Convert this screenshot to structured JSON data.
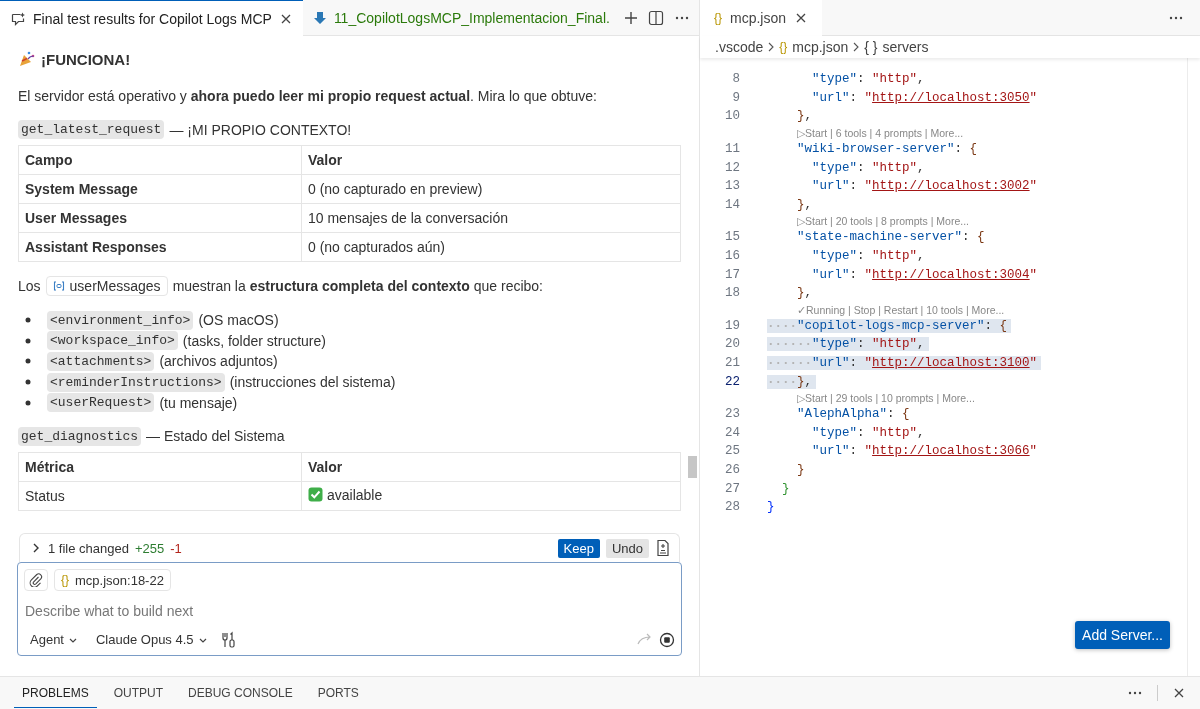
{
  "chat_tabs": [
    {
      "kind": "chat",
      "label": "Final test results for Copilot Logs MCP",
      "selected": true
    },
    {
      "kind": "file",
      "label": "11_CopilotLogsMCP_Implementacion_Final.",
      "selected": false
    }
  ],
  "chat": {
    "blocks": [
      {
        "kind": "heading",
        "text": "¡FUNCIONA!"
      },
      {
        "kind": "paragraph",
        "text": "El servidor está operativo y **ahora puedo leer mi propio request actual**. Mira lo que obtuve:"
      },
      {
        "kind": "tool",
        "code": "get_latest_request",
        "text": "— ¡MI PROPIO CONTEXTO!"
      },
      {
        "kind": "table",
        "bold_labels": true,
        "columns": [
          "Campo",
          "Valor"
        ],
        "rows": [
          {
            "cells": [
              "System Message",
              "0 (no capturado en preview)"
            ]
          },
          {
            "cells": [
              "User Messages",
              "10 mensajes de la conversación"
            ]
          },
          {
            "cells": [
              "Assistant Responses",
              "0 (no capturados aún)"
            ]
          }
        ]
      },
      {
        "kind": "reference",
        "before": "Los",
        "chip": "userMessages",
        "after": "muestran la **estructura completa del contexto** que recibo:"
      },
      {
        "kind": "list",
        "items": [
          {
            "code": "<environment_info>",
            "text": "(OS macOS)"
          },
          {
            "code": "<workspace_info>",
            "text": "(tasks, folder structure)"
          },
          {
            "code": "<attachments>",
            "text": "(archivos adjuntos)"
          },
          {
            "code": "<reminderInstructions>",
            "text": "(instrucciones del sistema)"
          },
          {
            "code": "<userRequest>",
            "text": "(tu mensaje)"
          }
        ]
      },
      {
        "kind": "tool",
        "code": "get_diagnostics",
        "text": "— Estado del Sistema"
      },
      {
        "kind": "table",
        "bold_labels": false,
        "columns": [
          "Métrica",
          "Valor"
        ],
        "rows": [
          {
            "cells": [
              "Status",
              "available"
            ],
            "checked": true
          }
        ]
      }
    ]
  },
  "changes": {
    "expanded": false,
    "summary": "1 file changed",
    "added": "+255",
    "removed": "-1",
    "keep": "Keep",
    "undo": "Undo"
  },
  "composer": {
    "attachment_icon": "{}",
    "attachment": "mcp.json:18-22",
    "placeholder": "Describe what to build next",
    "mode": "Agent",
    "model": "Claude Opus 4.5",
    "send_disabled": true
  },
  "editor_tabs": [
    {
      "icon": "{}",
      "label": "mcp.json",
      "selected": true
    }
  ],
  "breadcrumb": [
    {
      "text": ".vscode"
    },
    {
      "icon": "{}",
      "text": "mcp.json"
    },
    {
      "icon": "{ }",
      "text": "servers"
    }
  ],
  "code": [
    {
      "kind": "line",
      "number": "8",
      "selected": false,
      "current": false,
      "tokens": [
        {
          "kind": "key",
          "text": "      \"type\""
        },
        {
          "kind": "punct",
          "text": ": "
        },
        {
          "kind": "string",
          "text": "\"http\""
        },
        {
          "kind": "punct",
          "text": ","
        }
      ]
    },
    {
      "kind": "line",
      "number": "9",
      "selected": false,
      "current": false,
      "tokens": [
        {
          "kind": "key",
          "text": "      \"url\""
        },
        {
          "kind": "punct",
          "text": ": "
        },
        {
          "kind": "string",
          "text": "\""
        },
        {
          "kind": "link",
          "text": "http://localhost:3050"
        },
        {
          "kind": "string",
          "text": "\""
        }
      ]
    },
    {
      "kind": "line",
      "number": "10",
      "selected": false,
      "current": false,
      "tokens": [
        {
          "kind": "inner",
          "text": "    }"
        },
        {
          "kind": "punct",
          "text": ","
        }
      ]
    },
    {
      "kind": "lens",
      "text": "▷Start | 6 tools | 4 prompts | More..."
    },
    {
      "kind": "line",
      "number": "11",
      "selected": false,
      "current": false,
      "tokens": [
        {
          "kind": "key",
          "text": "    \"wiki-browser-server\""
        },
        {
          "kind": "punct",
          "text": ": "
        },
        {
          "kind": "inner",
          "text": "{"
        }
      ]
    },
    {
      "kind": "line",
      "number": "12",
      "selected": false,
      "current": false,
      "tokens": [
        {
          "kind": "key",
          "text": "      \"type\""
        },
        {
          "kind": "punct",
          "text": ": "
        },
        {
          "kind": "string",
          "text": "\"http\""
        },
        {
          "kind": "punct",
          "text": ","
        }
      ]
    },
    {
      "kind": "line",
      "number": "13",
      "selected": false,
      "current": false,
      "tokens": [
        {
          "kind": "key",
          "text": "      \"url\""
        },
        {
          "kind": "punct",
          "text": ": "
        },
        {
          "kind": "string",
          "text": "\""
        },
        {
          "kind": "link",
          "text": "http://localhost:3002"
        },
        {
          "kind": "string",
          "text": "\""
        }
      ]
    },
    {
      "kind": "line",
      "number": "14",
      "selected": false,
      "current": false,
      "tokens": [
        {
          "kind": "inner",
          "text": "    }"
        },
        {
          "kind": "punct",
          "text": ","
        }
      ]
    },
    {
      "kind": "lens",
      "text": "▷Start | 20 tools | 8 prompts | More..."
    },
    {
      "kind": "line",
      "number": "15",
      "selected": false,
      "current": false,
      "tokens": [
        {
          "kind": "key",
          "text": "    \"state-machine-server\""
        },
        {
          "kind": "punct",
          "text": ": "
        },
        {
          "kind": "inner",
          "text": "{"
        }
      ]
    },
    {
      "kind": "line",
      "number": "16",
      "selected": false,
      "current": false,
      "tokens": [
        {
          "kind": "key",
          "text": "      \"type\""
        },
        {
          "kind": "punct",
          "text": ": "
        },
        {
          "kind": "string",
          "text": "\"http\""
        },
        {
          "kind": "punct",
          "text": ","
        }
      ]
    },
    {
      "kind": "line",
      "number": "17",
      "selected": false,
      "current": false,
      "tokens": [
        {
          "kind": "key",
          "text": "      \"url\""
        },
        {
          "kind": "punct",
          "text": ": "
        },
        {
          "kind": "string",
          "text": "\""
        },
        {
          "kind": "link",
          "text": "http://localhost:3004"
        },
        {
          "kind": "string",
          "text": "\""
        }
      ]
    },
    {
      "kind": "line",
      "number": "18",
      "selected": false,
      "current": false,
      "tokens": [
        {
          "kind": "inner",
          "text": "    }"
        },
        {
          "kind": "punct",
          "text": ","
        }
      ]
    },
    {
      "kind": "lens",
      "text": "✓Running | Stop | Restart | 10 tools | More..."
    },
    {
      "kind": "line",
      "number": "19",
      "selected": true,
      "current": false,
      "tokens": [
        {
          "kind": "key",
          "text": "    \"copilot-logs-mcp-server\""
        },
        {
          "kind": "punct",
          "text": ": "
        },
        {
          "kind": "inner",
          "text": "{"
        }
      ]
    },
    {
      "kind": "line",
      "number": "20",
      "selected": true,
      "current": false,
      "tokens": [
        {
          "kind": "key",
          "text": "      \"type\""
        },
        {
          "kind": "punct",
          "text": ": "
        },
        {
          "kind": "string",
          "text": "\"http\""
        },
        {
          "kind": "punct",
          "text": ","
        }
      ]
    },
    {
      "kind": "line",
      "number": "21",
      "selected": true,
      "current": false,
      "tokens": [
        {
          "kind": "key",
          "text": "      \"url\""
        },
        {
          "kind": "punct",
          "text": ": "
        },
        {
          "kind": "string",
          "text": "\""
        },
        {
          "kind": "link",
          "text": "http://localhost:3100"
        },
        {
          "kind": "string",
          "text": "\""
        }
      ]
    },
    {
      "kind": "line",
      "number": "22",
      "selected": true,
      "current": true,
      "tokens": [
        {
          "kind": "inner",
          "text": "    }"
        },
        {
          "kind": "punct",
          "text": ","
        }
      ]
    },
    {
      "kind": "lens",
      "text": "▷Start | 29 tools | 10 prompts | More..."
    },
    {
      "kind": "line",
      "number": "23",
      "selected": false,
      "current": false,
      "tokens": [
        {
          "kind": "key",
          "text": "    \"AlephAlpha\""
        },
        {
          "kind": "punct",
          "text": ": "
        },
        {
          "kind": "inner",
          "text": "{"
        }
      ]
    },
    {
      "kind": "line",
      "number": "24",
      "selected": false,
      "current": false,
      "tokens": [
        {
          "kind": "key",
          "text": "      \"type\""
        },
        {
          "kind": "punct",
          "text": ": "
        },
        {
          "kind": "string",
          "text": "\"http\""
        },
        {
          "kind": "punct",
          "text": ","
        }
      ]
    },
    {
      "kind": "line",
      "number": "25",
      "selected": false,
      "current": false,
      "tokens": [
        {
          "kind": "key",
          "text": "      \"url\""
        },
        {
          "kind": "punct",
          "text": ": "
        },
        {
          "kind": "string",
          "text": "\""
        },
        {
          "kind": "link",
          "text": "http://localhost:3066"
        },
        {
          "kind": "string",
          "text": "\""
        }
      ]
    },
    {
      "kind": "line",
      "number": "26",
      "selected": false,
      "current": false,
      "tokens": [
        {
          "kind": "inner",
          "text": "    }"
        }
      ]
    },
    {
      "kind": "line",
      "number": "27",
      "selected": false,
      "current": false,
      "tokens": [
        {
          "kind": "middle",
          "text": "  }"
        }
      ]
    },
    {
      "kind": "line",
      "number": "28",
      "selected": false,
      "current": false,
      "tokens": [
        {
          "kind": "outer",
          "text": "}"
        }
      ]
    }
  ],
  "add_server": "Add Server...",
  "panel_tabs": [
    {
      "label": "PROBLEMS",
      "selected": true
    },
    {
      "label": "OUTPUT",
      "selected": false
    },
    {
      "label": "DEBUG CONSOLE",
      "selected": false
    },
    {
      "label": "PORTS",
      "selected": false
    }
  ]
}
